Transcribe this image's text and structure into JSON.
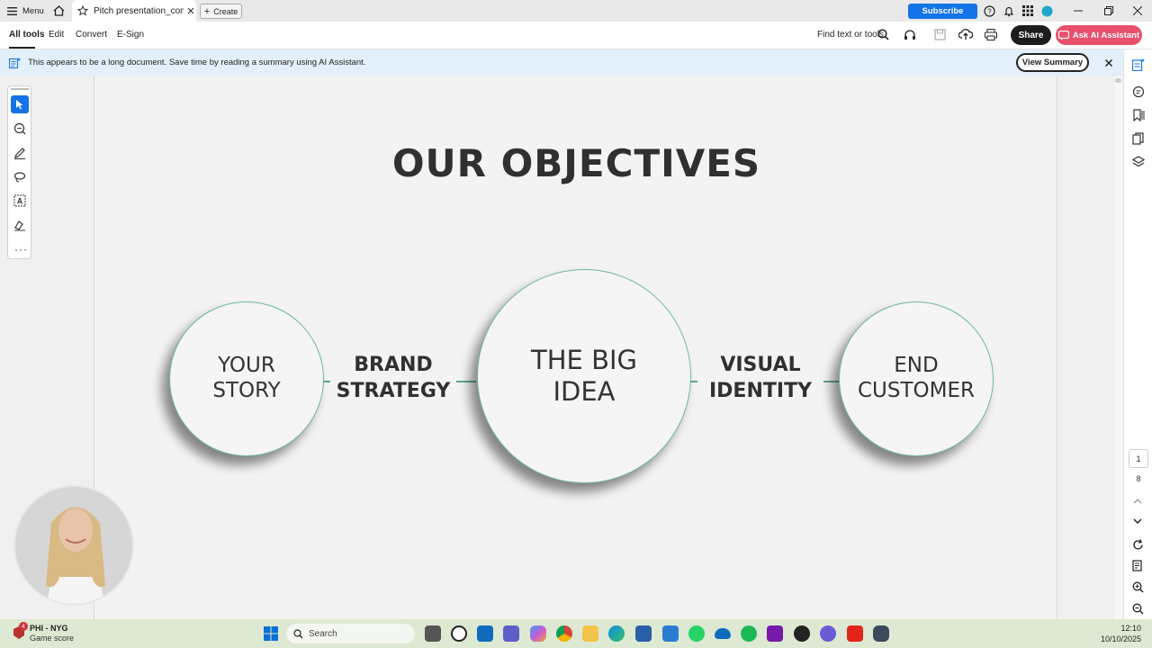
{
  "titlebar": {
    "menu_label": "Menu",
    "tab_title": "Pitch presentation_com...",
    "create_label": "Create",
    "subscribe_label": "Subscribe"
  },
  "toolbar": {
    "items": [
      "All tools",
      "Edit",
      "Convert",
      "E-Sign"
    ],
    "find_label": "Find text or tools",
    "share_label": "Share",
    "ask_ai_label": "Ask AI Assistant"
  },
  "banner": {
    "text": "This appears to be a long document. Save time by reading a summary using AI Assistant.",
    "button_label": "View Summary"
  },
  "slide": {
    "heading": "OUR OBJECTIVES",
    "circles": [
      "YOUR\nSTORY",
      "THE BIG\nIDEA",
      "END\nCUSTOMER"
    ],
    "connectors": [
      "BRAND\nSTRATEGY",
      "VISUAL\nIDENTITY"
    ]
  },
  "pager": {
    "current_page": "1",
    "total_pages": "8"
  },
  "taskbar": {
    "weather_title": "PHI - NYG",
    "weather_sub": "Game score",
    "search_placeholder": "Search",
    "time": "12:10",
    "date": "10/10/2025",
    "badge_count": "4"
  },
  "colors": {
    "accent_blue": "#1473e6",
    "ai_pink": "#e8506c",
    "circle_ring": "#6ab89e",
    "banner_bg": "#e3f0fb"
  }
}
